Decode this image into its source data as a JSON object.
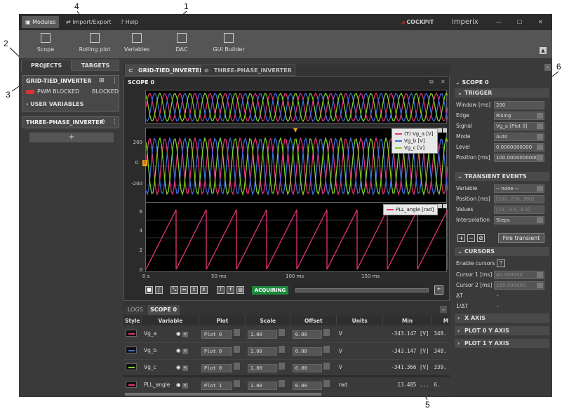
{
  "annotations": [
    "1",
    "2",
    "3",
    "4",
    "5",
    "6"
  ],
  "topbar": {
    "menu": [
      {
        "label": "Modules",
        "icon": "modules-icon"
      },
      {
        "label": "Import/Export",
        "icon": "import-export-icon"
      },
      {
        "label": "Help",
        "icon": "help-icon"
      }
    ],
    "brand_cockpit": "COCKPIT",
    "brand_imperix": "imperix"
  },
  "ribbon": [
    {
      "label": "Scope",
      "icon": "scope-icon"
    },
    {
      "label": "Rolling plot",
      "icon": "rolling-plot-icon"
    },
    {
      "label": "Variables",
      "icon": "variables-icon"
    },
    {
      "label": "DAC",
      "icon": "dac-icon"
    },
    {
      "label": "GUI Builder",
      "icon": "gui-builder-icon"
    }
  ],
  "left": {
    "tabs": [
      "PROJECTS",
      "TARGETS"
    ],
    "project1": {
      "name": "GRID-TIED_INVERTER",
      "status_label": "PWM BLOCKED",
      "status_value": "BLOCKED",
      "user_vars": "USER VARIABLES"
    },
    "project2": {
      "name": "THREE-PHASE_INVERTER"
    }
  },
  "center": {
    "tabs": [
      "GRID-TIED_INVERTER",
      "THREE-PHASE_INVERTER"
    ],
    "scope_title": "SCOPE 0",
    "acquiring": "ACQUIRING",
    "legend0": [
      "(T) Vg_a  [V]",
      "Vg_b  [V]",
      "Vg_c  [V]"
    ],
    "legend1": [
      "PLL_angle  [rad]"
    ],
    "y_ticks_top": [
      "200",
      "0",
      "-200"
    ],
    "y_ticks_bot": [
      "6",
      "4",
      "2",
      "0"
    ],
    "x_ticks": [
      "0 s",
      "50 ms",
      "100 ms",
      "150 ms"
    ],
    "trigger_marker": "T"
  },
  "bottom": {
    "tabs": [
      "LOGS",
      "SCOPE 0"
    ],
    "headers": [
      "Style",
      "Variable",
      "Plot",
      "Scale",
      "Offset",
      "Units",
      "Min",
      "M"
    ],
    "rows": [
      {
        "color": "#e8317a",
        "var": "Vg_a",
        "plot": "Plot 0",
        "scale": "1.00",
        "offset": "0.00",
        "units": "V",
        "min": "-343.147 [V]",
        "max": "348."
      },
      {
        "color": "#3c6ed8",
        "var": "Vg_b",
        "plot": "Plot 0",
        "scale": "1.00",
        "offset": "0.00",
        "units": "V",
        "min": "-343.147 [V]",
        "max": "348."
      },
      {
        "color": "#7ed321",
        "var": "Vg_c",
        "plot": "Plot 0",
        "scale": "1.00",
        "offset": "0.00",
        "units": "V",
        "min": "-341.366 [V]",
        "max": "339."
      },
      {
        "color": "#e8317a",
        "var": "PLL_angle",
        "plot": "Plot 1",
        "scale": "1.00",
        "offset": "0.00",
        "units": "rad",
        "min": "13.485 ...",
        "max": "6."
      }
    ]
  },
  "right": {
    "title": "SCOPE 0",
    "trigger": {
      "header": "TRIGGER",
      "rows": [
        [
          "Window [ms]",
          "200"
        ],
        [
          "Edge",
          "Rising"
        ],
        [
          "Signal",
          "Vg_a [Plot 0]"
        ],
        [
          "Mode",
          "Auto"
        ],
        [
          "Level",
          "0.0000000000"
        ],
        [
          "Position [ms]",
          "100.0000000000"
        ]
      ]
    },
    "transient": {
      "header": "TRANSIENT EVENTS",
      "rows": [
        [
          "Variable",
          "-- none --"
        ],
        [
          "Position [ms]",
          "[100, 200, 300]"
        ],
        [
          "Values",
          "[13, -4.0, 3.0]"
        ],
        [
          "Interpolation",
          "Steps"
        ]
      ],
      "fire": "Fire transient"
    },
    "cursors": {
      "header": "CURSORS",
      "enable": "Enable cursors",
      "rows": [
        [
          "Cursor 1 [ms]",
          "40.000000"
        ],
        [
          "Cursor 2 [ms]",
          "160.000000"
        ],
        [
          "ΔT",
          "-"
        ],
        [
          "1/ΔT",
          "-"
        ]
      ]
    },
    "collapsed": [
      "X AXIS",
      "PLOT 0 Y AXIS",
      "PLOT 1 Y AXIS"
    ]
  },
  "colors": {
    "a": "#e8317a",
    "b": "#3c6ed8",
    "c": "#7ed321",
    "acq": "#1e8a3c"
  }
}
